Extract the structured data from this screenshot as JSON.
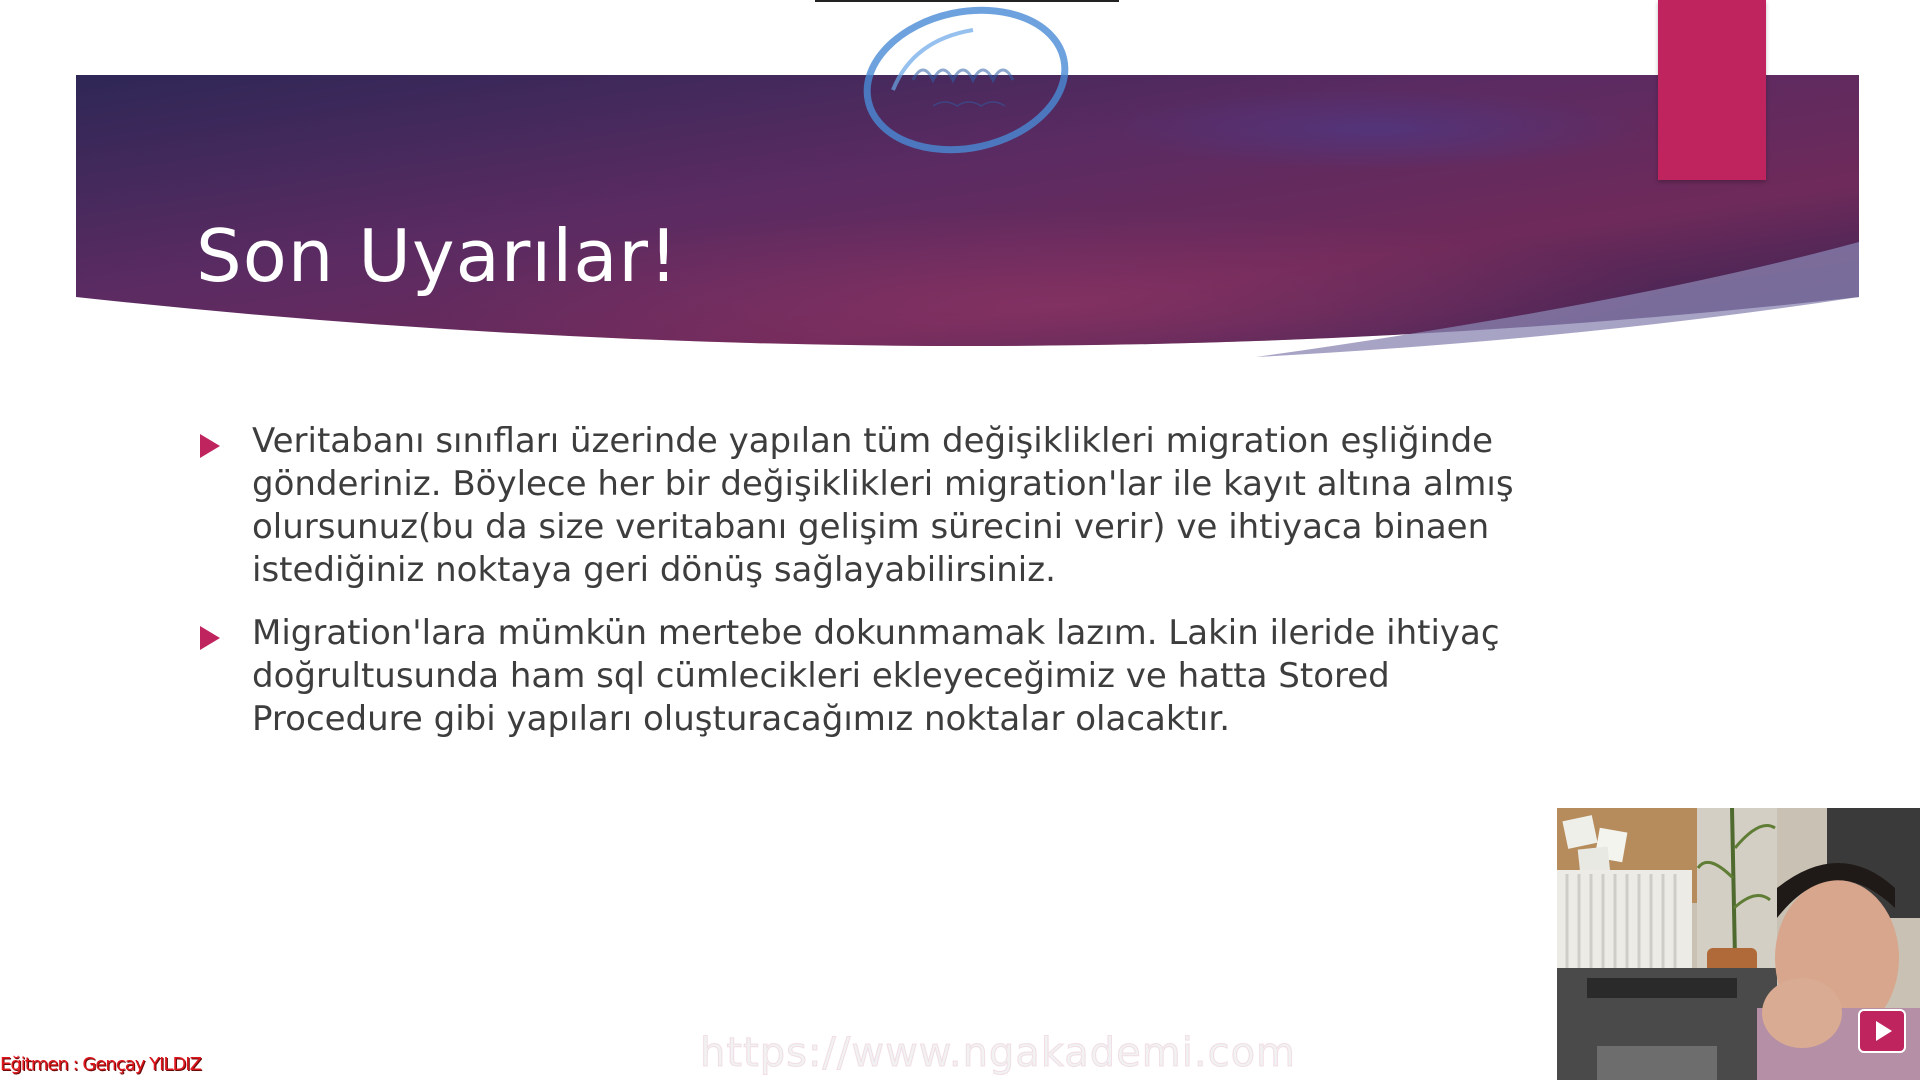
{
  "slide": {
    "title": "Son Uyarılar!",
    "bullets": [
      "Veritabanı sınıfları üzerinde yapılan tüm değişiklikleri migration eşliğinde gönderiniz. Böylece her bir değişiklikleri migration'lar ile kayıt altına almış olursunuz(bu da size veritabanı gelişim sürecini verir) ve ihtiyaca binaen istediğiniz noktaya geri dönüş sağlayabilirsiniz.",
      "Migration'lara mümkün mertebe dokunmamak lazım. Lakin ileride ihtiyaç doğrultusunda ham sql cümlecikleri ekleyeceğimiz ve hatta Stored Procedure gibi yapıları oluşturacağımız noktalar olacaktır."
    ]
  },
  "overlay": {
    "watermark_url": "https://www.ngakademi.com",
    "instructor_label": "Eğitmen : Gençay YILDIZ",
    "logo_icon": "ngakademi-logo",
    "play_icon": "play-icon"
  },
  "colors": {
    "banner_dark": "#2d2350",
    "banner_mid": "#6b2a5e",
    "accent": "#c0245f",
    "body_text": "#3d3d3d"
  }
}
